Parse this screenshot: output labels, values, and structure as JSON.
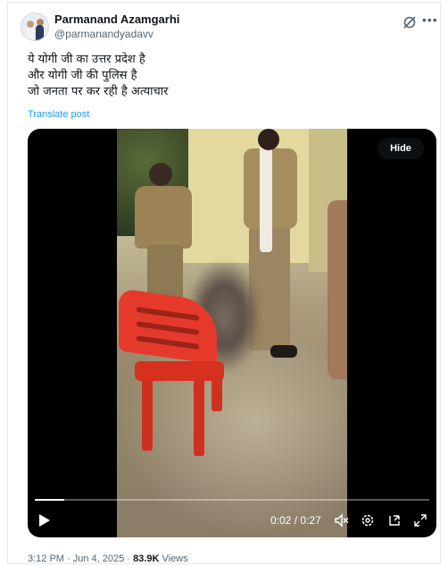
{
  "author": {
    "name": "Parmanand Azamgarhi",
    "handle": "@parmanandyadavv"
  },
  "tweet": {
    "lines": [
      "ये योगी जी का उत्तर प्रदेश है",
      "और योगी जी की पुलिस है",
      "जो जनता पर कर रही है अत्याचार"
    ],
    "translate_label": "Translate post"
  },
  "video": {
    "hide_label": "Hide",
    "current_time": "0:02",
    "separator": "/",
    "duration": "0:27",
    "progress_fraction": 0.074,
    "controls": {
      "play_icon": "play-icon",
      "mute_icon": "volume-muted-icon",
      "settings_icon": "settings-icon",
      "pip_icon": "picture-in-picture-icon",
      "fullscreen_icon": "fullscreen-icon"
    }
  },
  "meta": {
    "time": "3:12 PM",
    "dot1": "·",
    "date": "Jun 4, 2025",
    "dot2": "·",
    "views_count": "83.9K",
    "views_label": "Views"
  },
  "colors": {
    "accent": "#1d9bf0",
    "secondary_text": "#536471",
    "chair_red": "#e53a2b"
  }
}
